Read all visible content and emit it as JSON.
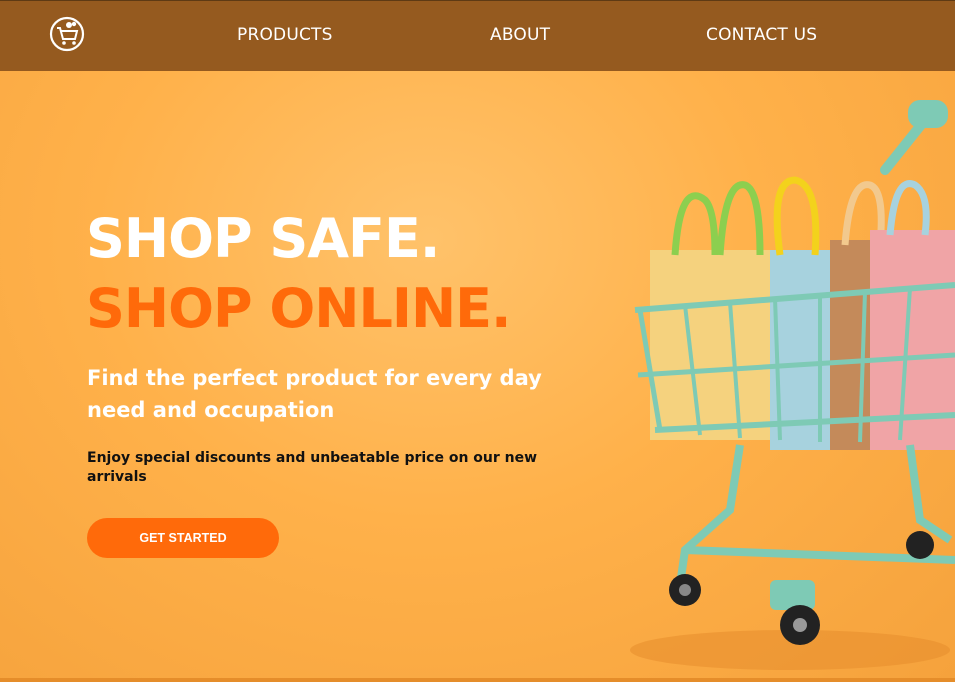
{
  "nav": {
    "logo_icon": "shopping-cart-logo-icon",
    "links": [
      {
        "label": "PRODUCTS"
      },
      {
        "label": "ABOUT"
      },
      {
        "label": "CONTACT US"
      }
    ]
  },
  "hero": {
    "headline_line1": "SHOP SAFE.",
    "headline_line2": "SHOP ONLINE.",
    "subheading": "Find the perfect product for every day need and occupation",
    "promo": "Enjoy special discounts and unbeatable price on our new arrivals",
    "cta_label": "GET STARTED",
    "image_icon": "shopping-cart-with-bags-illustration"
  },
  "colors": {
    "nav_background": "#955a1f",
    "hero_background": "#ffb14a",
    "accent_orange": "#ff6a0a",
    "cart_teal": "#7ecab5"
  }
}
